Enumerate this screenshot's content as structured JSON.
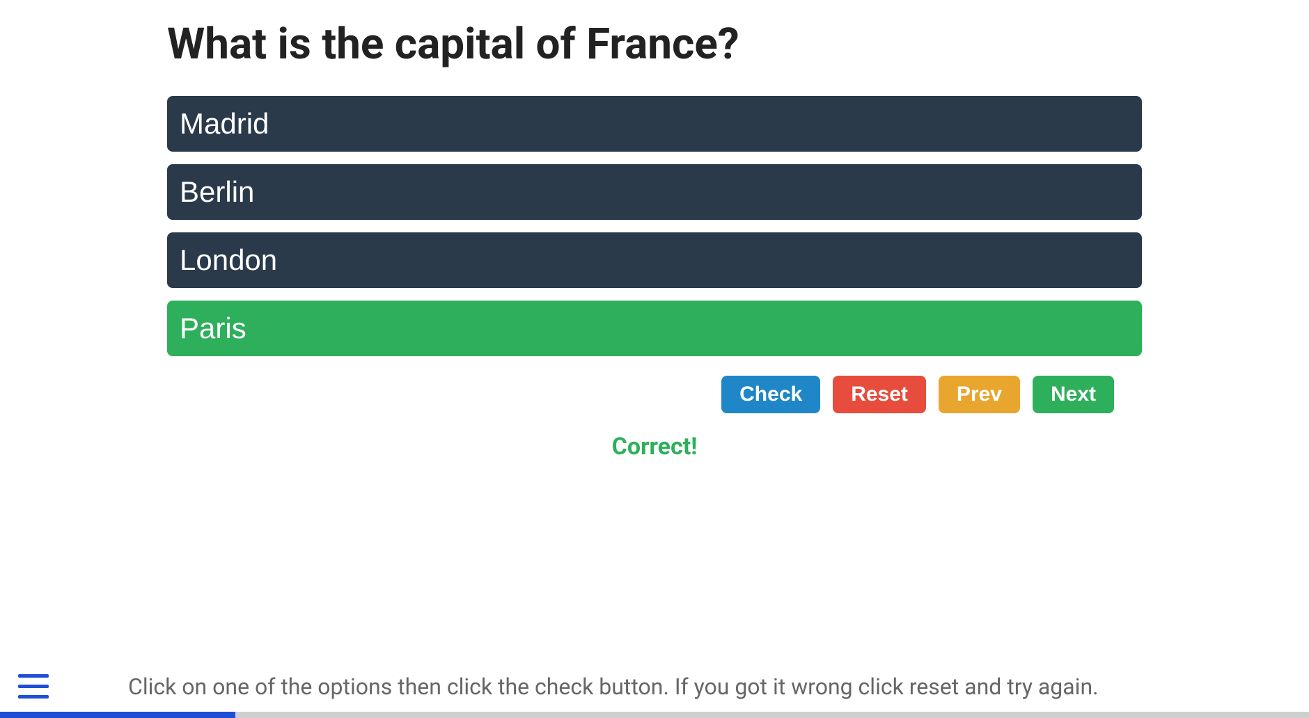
{
  "question": {
    "title": "What is the capital of France?",
    "options": [
      {
        "label": "Madrid",
        "state": "default"
      },
      {
        "label": "Berlin",
        "state": "default"
      },
      {
        "label": "London",
        "state": "default"
      },
      {
        "label": "Paris",
        "state": "correct"
      }
    ]
  },
  "controls": {
    "check": "Check",
    "reset": "Reset",
    "prev": "Prev",
    "next": "Next"
  },
  "feedback": "Correct!",
  "instructions": "Click on one of the options then click the check button. If you got it wrong click reset and try again.",
  "progress": {
    "percent": 18
  },
  "colors": {
    "option_default": "#2a3a4a",
    "option_correct": "#2eaf5b",
    "check": "#1f87c7",
    "reset": "#e74c3c",
    "prev": "#e9a62f",
    "next": "#2eaf5b",
    "accent": "#1e4fd6"
  }
}
